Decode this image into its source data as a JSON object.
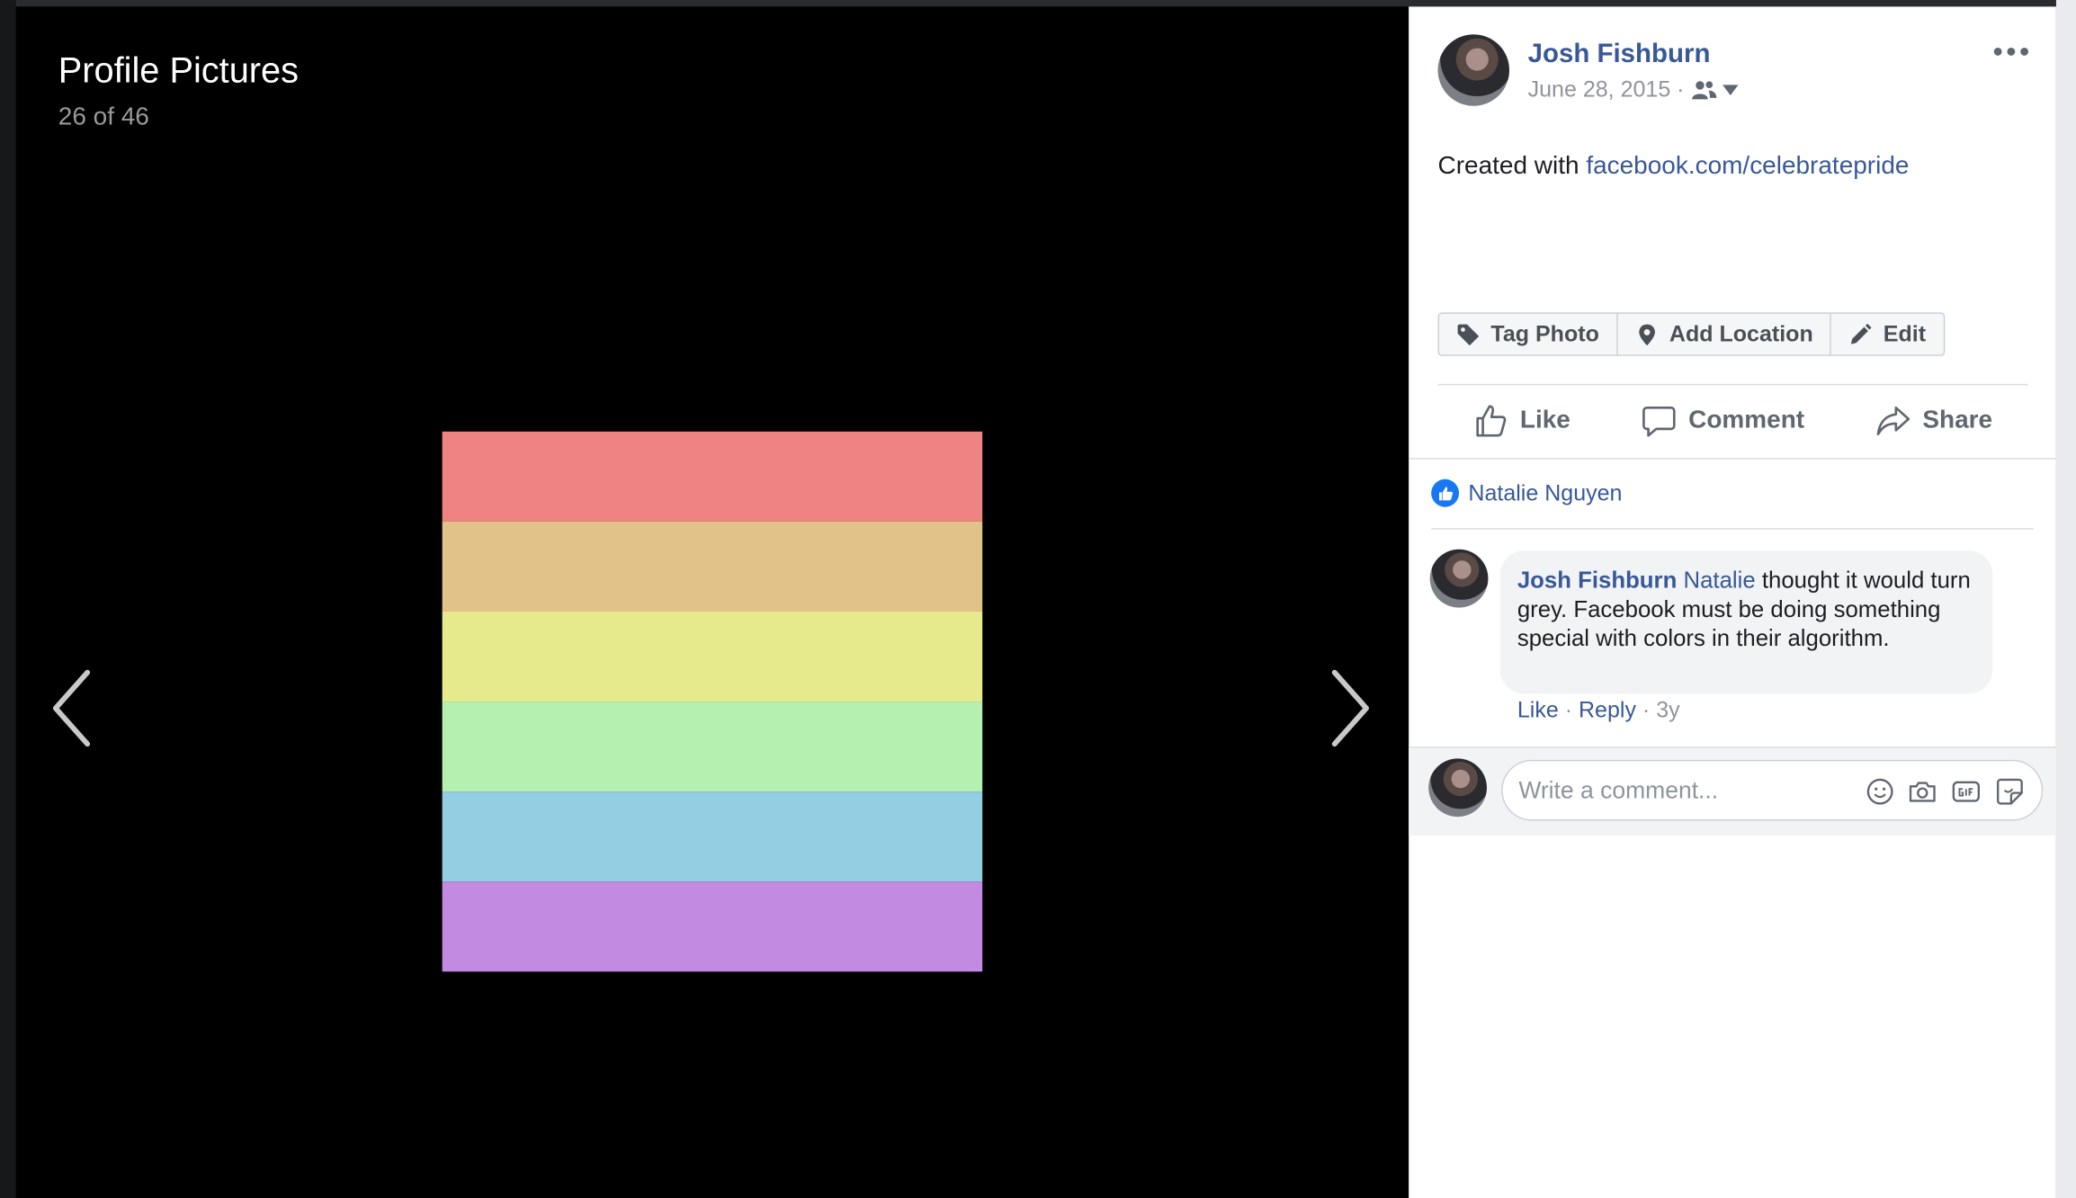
{
  "album": {
    "title": "Profile Pictures",
    "count": "26 of 46"
  },
  "photo": {
    "stripes": [
      "#ef8282",
      "#e1c38a",
      "#e6ea8c",
      "#b5f0b1",
      "#93cfe2",
      "#c28ae0"
    ]
  },
  "post": {
    "author": "Josh Fishburn",
    "date": "June 28, 2015 ·",
    "caption_prefix": "Created with",
    "caption_link": "facebook.com/celebratepride"
  },
  "photo_actions": {
    "tag": "Tag Photo",
    "location": "Add Location",
    "edit": "Edit"
  },
  "social": {
    "like": "Like",
    "comment": "Comment",
    "share": "Share"
  },
  "likes": {
    "names": "Natalie Nguyen"
  },
  "comment": {
    "author": "Josh Fishburn",
    "mention": "Natalie",
    "text": " thought it would turn grey. Facebook must be doing something special with colors in their algorithm.",
    "like": "Like",
    "sep1": " · ",
    "reply": "Reply",
    "sep2": " · ",
    "age": "3y"
  },
  "composer": {
    "placeholder": "Write a comment..."
  },
  "icons": {
    "prev": "chevron-left-icon",
    "next": "chevron-right-icon",
    "more": "more-horizontal-icon",
    "audience": "friends-icon",
    "tag": "tag-icon",
    "location": "map-pin-icon",
    "edit": "pencil-icon",
    "like": "thumbs-up-icon",
    "comment": "comment-icon",
    "share": "share-icon",
    "emoji": "emoji-icon",
    "camera": "camera-icon",
    "gif": "gif-icon",
    "sticker": "sticker-icon"
  },
  "colors": {
    "link": "#385898",
    "like_blue": "#1877f2",
    "viewer_bg": "#000000"
  }
}
